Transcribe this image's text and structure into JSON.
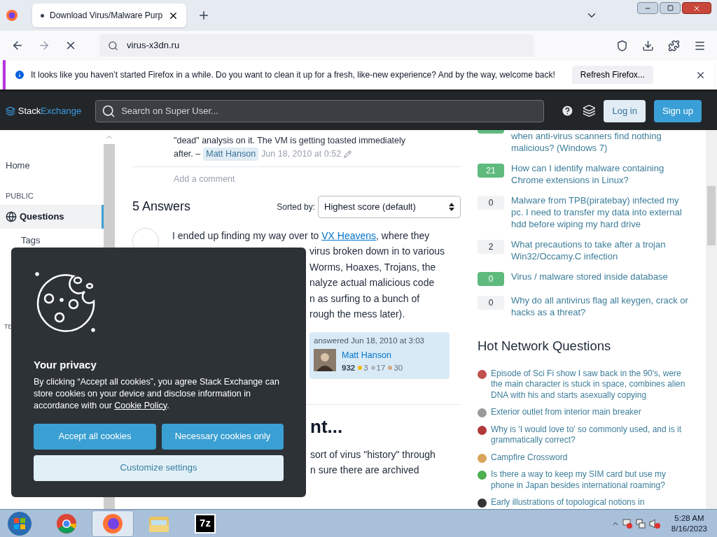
{
  "browser": {
    "tab": {
      "title": "Download Virus/Malware Purp",
      "loading": true
    },
    "url": "virus-x3dn.ru"
  },
  "notification": {
    "message": "It looks like you haven’t started Firefox in a while. Do you want to clean it up for a fresh, like-new experience? And by the way, welcome back!",
    "button": "Refresh Firefox..."
  },
  "site_header": {
    "logo_left": "Stack",
    "logo_right": "Exchange",
    "search_placeholder": "Search on Super User...",
    "login": "Log in",
    "signup": "Sign up"
  },
  "sidebar": {
    "items": [
      {
        "kind": "link",
        "label": "Home",
        "selected": false
      },
      {
        "kind": "heading",
        "label": "PUBLIC"
      },
      {
        "kind": "link",
        "label": "Questions",
        "selected": true
      },
      {
        "kind": "sublink",
        "label": "Tags",
        "selected": false
      },
      {
        "kind": "heading_cut",
        "label": "TE"
      }
    ]
  },
  "comment": {
    "lines": [
      "\"dead\" analysis on it. The VM is getting toasted immediately"
    ],
    "lead": "after. –",
    "user": "Matt Hanson",
    "time": "Jun 18, 2010 at 0:52"
  },
  "add_comment": "Add a comment",
  "answers_header": {
    "count": "5 Answers",
    "sort_label": "Sorted by:",
    "sort_value": "Highest score (default)"
  },
  "answer": {
    "lines": [
      {
        "kind": "link_line",
        "before": "I ended up finding my way over to ",
        "link": "VX Heavens",
        "after": ", where they"
      },
      {
        "kind": "fragment",
        "text": "virus broken down in to various"
      },
      {
        "kind": "fragment",
        "text": "Worms, Hoaxes, Trojans, the"
      },
      {
        "kind": "fragment",
        "text": "nalyze actual malicious code"
      },
      {
        "kind": "fragment",
        "text": "n as surfing to a bunch of"
      },
      {
        "kind": "fragment",
        "text": "rough the mess later)."
      }
    ],
    "signature": {
      "action": "answered Jun 18, 2010 at 3:03",
      "user": "Matt Hanson",
      "reputation": "932",
      "badges": [
        {
          "count": "3",
          "color": "#f1b600"
        },
        {
          "count": "17",
          "color": "#b4b8bc"
        },
        {
          "count": "30",
          "color": "#d1a684"
        }
      ]
    }
  },
  "next_answer": {
    "heading": "nt...",
    "lines": [
      "sort of virus \"history\" through",
      "n sure there are archived"
    ]
  },
  "related": [
    {
      "accepted": true,
      "title": "when anti-virus scanners find nothing malicious? (Windows 7)"
    },
    {
      "score": "21",
      "accepted": true,
      "title": "How can I identify malware containing Chrome extensions in Linux?"
    },
    {
      "score": "0",
      "accepted": false,
      "title": "Malware from TPB(piratebay) infected my pc. I need to transfer my data into external hdd before wiping my hard drive"
    },
    {
      "score": "2",
      "accepted": false,
      "title": "What precautions to take after a trojan Win32/Occamy.C infection"
    },
    {
      "score": "0",
      "accepted": true,
      "title": "Virus / malware stored inside database"
    },
    {
      "score": "0",
      "accepted": false,
      "title": "Why do all antivirus flag all keygen, crack or hacks as a threat?"
    }
  ],
  "hot_network": {
    "title": "Hot Network Questions",
    "items": [
      {
        "title": "Episode of Sci Fi show I saw back in the 90's, were the main character is stuck in space, combines alien DNA with his and starts asexually copying",
        "color": "#c0504d"
      },
      {
        "title": "Exterior outlet from interior main breaker",
        "color": "#9a9a9a"
      },
      {
        "title": "Why is 'I would love to' so commonly used, and is it grammatically correct?",
        "color": "#b03a3a"
      },
      {
        "title": "Campfire Crossword",
        "color": "#d9a45a"
      },
      {
        "title": "Is there a way to keep my SIM card but use my phone in Japan besides international roaming?",
        "color": "#4caf50"
      },
      {
        "title": "Early illustrations of topological notions in",
        "color": "#333333"
      }
    ]
  },
  "cookie_banner": {
    "title": "Your privacy",
    "before": "By clicking “Accept all cookies”, you agree Stack Exchange can store cookies on your device and disclose information in accordance with our ",
    "link": "Cookie Policy",
    "after": ".",
    "accept": "Accept all cookies",
    "necessary": "Necessary cookies only",
    "customize": "Customize settings"
  },
  "taskbar": {
    "apps": [
      {
        "kind": "chrome",
        "selected": false
      },
      {
        "kind": "firefox",
        "selected": true
      },
      {
        "kind": "explorer",
        "selected": false
      },
      {
        "kind": "sevenzip",
        "label": "7z",
        "selected": false
      }
    ],
    "time": "5:28 AM",
    "date": "8/16/2023"
  }
}
